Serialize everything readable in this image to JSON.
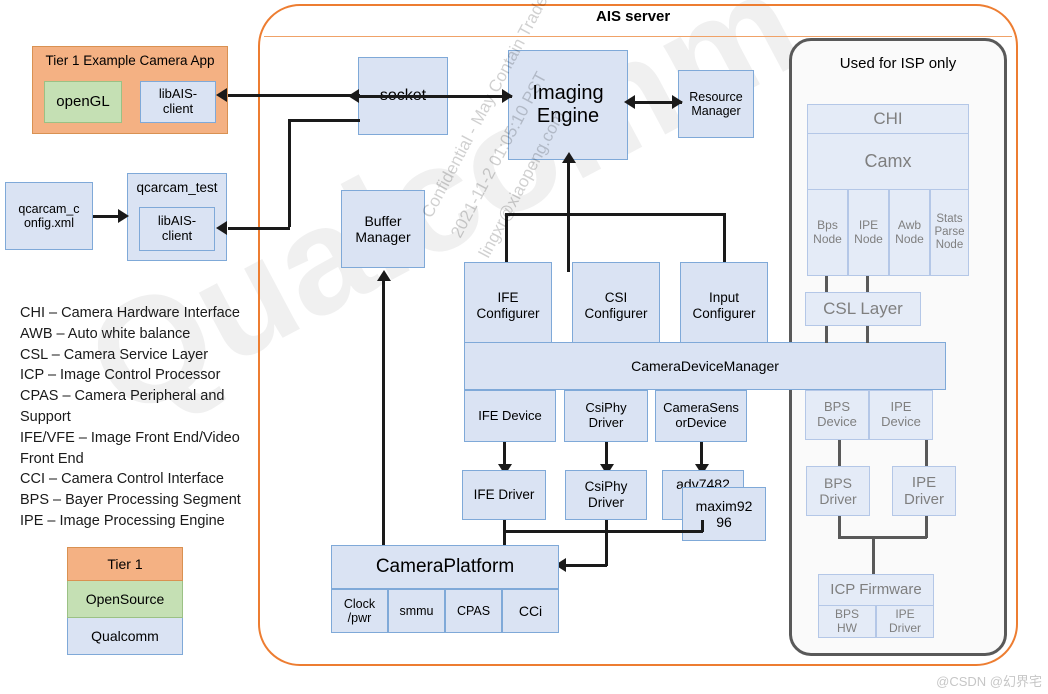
{
  "diagram": {
    "ais_server_title": "AIS server",
    "isp_panel_title": "Used for ISP only"
  },
  "tier1_app": {
    "title": "Tier 1 Example Camera App",
    "opengl": "openGL",
    "libais": "libAIS-\nclient"
  },
  "qcarcam": {
    "config_xml": "qcarcam_c\nonfig.xml",
    "test_title": "qcarcam_test",
    "libais": "libAIS-\nclient"
  },
  "server_blocks": {
    "socket": "socket",
    "imaging_engine": "Imaging\nEngine",
    "resource_manager": "Resource\nManager",
    "buffer_manager": "Buffer\nManager",
    "ife_configurer": "IFE\nConfigurer",
    "csi_configurer": "CSI\nConfigurer",
    "input_configurer": "Input\nConfigurer",
    "camera_device_manager": "CameraDeviceManager",
    "ife_device": "IFE Device",
    "csiphy_driver_dev": "CsiPhy\nDriver",
    "camera_sensor_device": "CameraSens\norDevice",
    "ife_driver": "IFE Driver",
    "csiphy_driver": "CsiPhy\nDriver",
    "adv7482": "adv7482",
    "maxim9296": "maxim92\n96",
    "camera_platform": "CameraPlatform",
    "clock_pwr": "Clock\n/pwr",
    "smmu": "smmu",
    "cpas": "CPAS",
    "cci": "CCi"
  },
  "isp_blocks": {
    "chi": "CHI",
    "camx": "Camx",
    "bps_node": "Bps\nNode",
    "ipe_node": "IPE\nNode",
    "awb_node": "Awb\nNode",
    "stats_parse_node": "Stats\nParse\nNode",
    "csl_layer": "CSL Layer",
    "bps_device": "BPS\nDevice",
    "ipe_device": "IPE\nDevice",
    "bps_driver": "BPS\nDriver",
    "ipe_driver": "IPE\nDriver",
    "icp_firmware": "ICP Firmware",
    "bps_hw": "BPS\nHW",
    "ipe_driver_hw": "IPE\nDriver"
  },
  "legend_text": {
    "lines": [
      "CHI – Camera Hardware Interface",
      "AWB – Auto white balance",
      "CSL – Camera Service Layer",
      "ICP – Image Control Processor",
      "CPAS – Camera Peripheral and Support",
      "IFE/VFE – Image Front End/Video Front End",
      "CCI – Camera Control Interface",
      "BPS – Bayer Processing Segment",
      "IPE – Image Processing Engine"
    ]
  },
  "color_key": {
    "tier1": "Tier 1",
    "opensource": "OpenSource",
    "qualcomm": "Qualcomm"
  },
  "colors": {
    "tier1_fill": "#f4b183",
    "opensource_fill": "#c5e0b4",
    "qualcomm_fill": "#dae3f3",
    "ais_border": "#ed7d31",
    "isp_border": "#595959"
  },
  "watermark": {
    "brand": "Qualcomm",
    "confidential": "Confidential - May Contain Trade Secrets",
    "timestamp": "2021-11-2 01:05:10 PST",
    "email": "lingxr@xiaopeng.com",
    "attribution": "@CSDN @幻界宅"
  }
}
